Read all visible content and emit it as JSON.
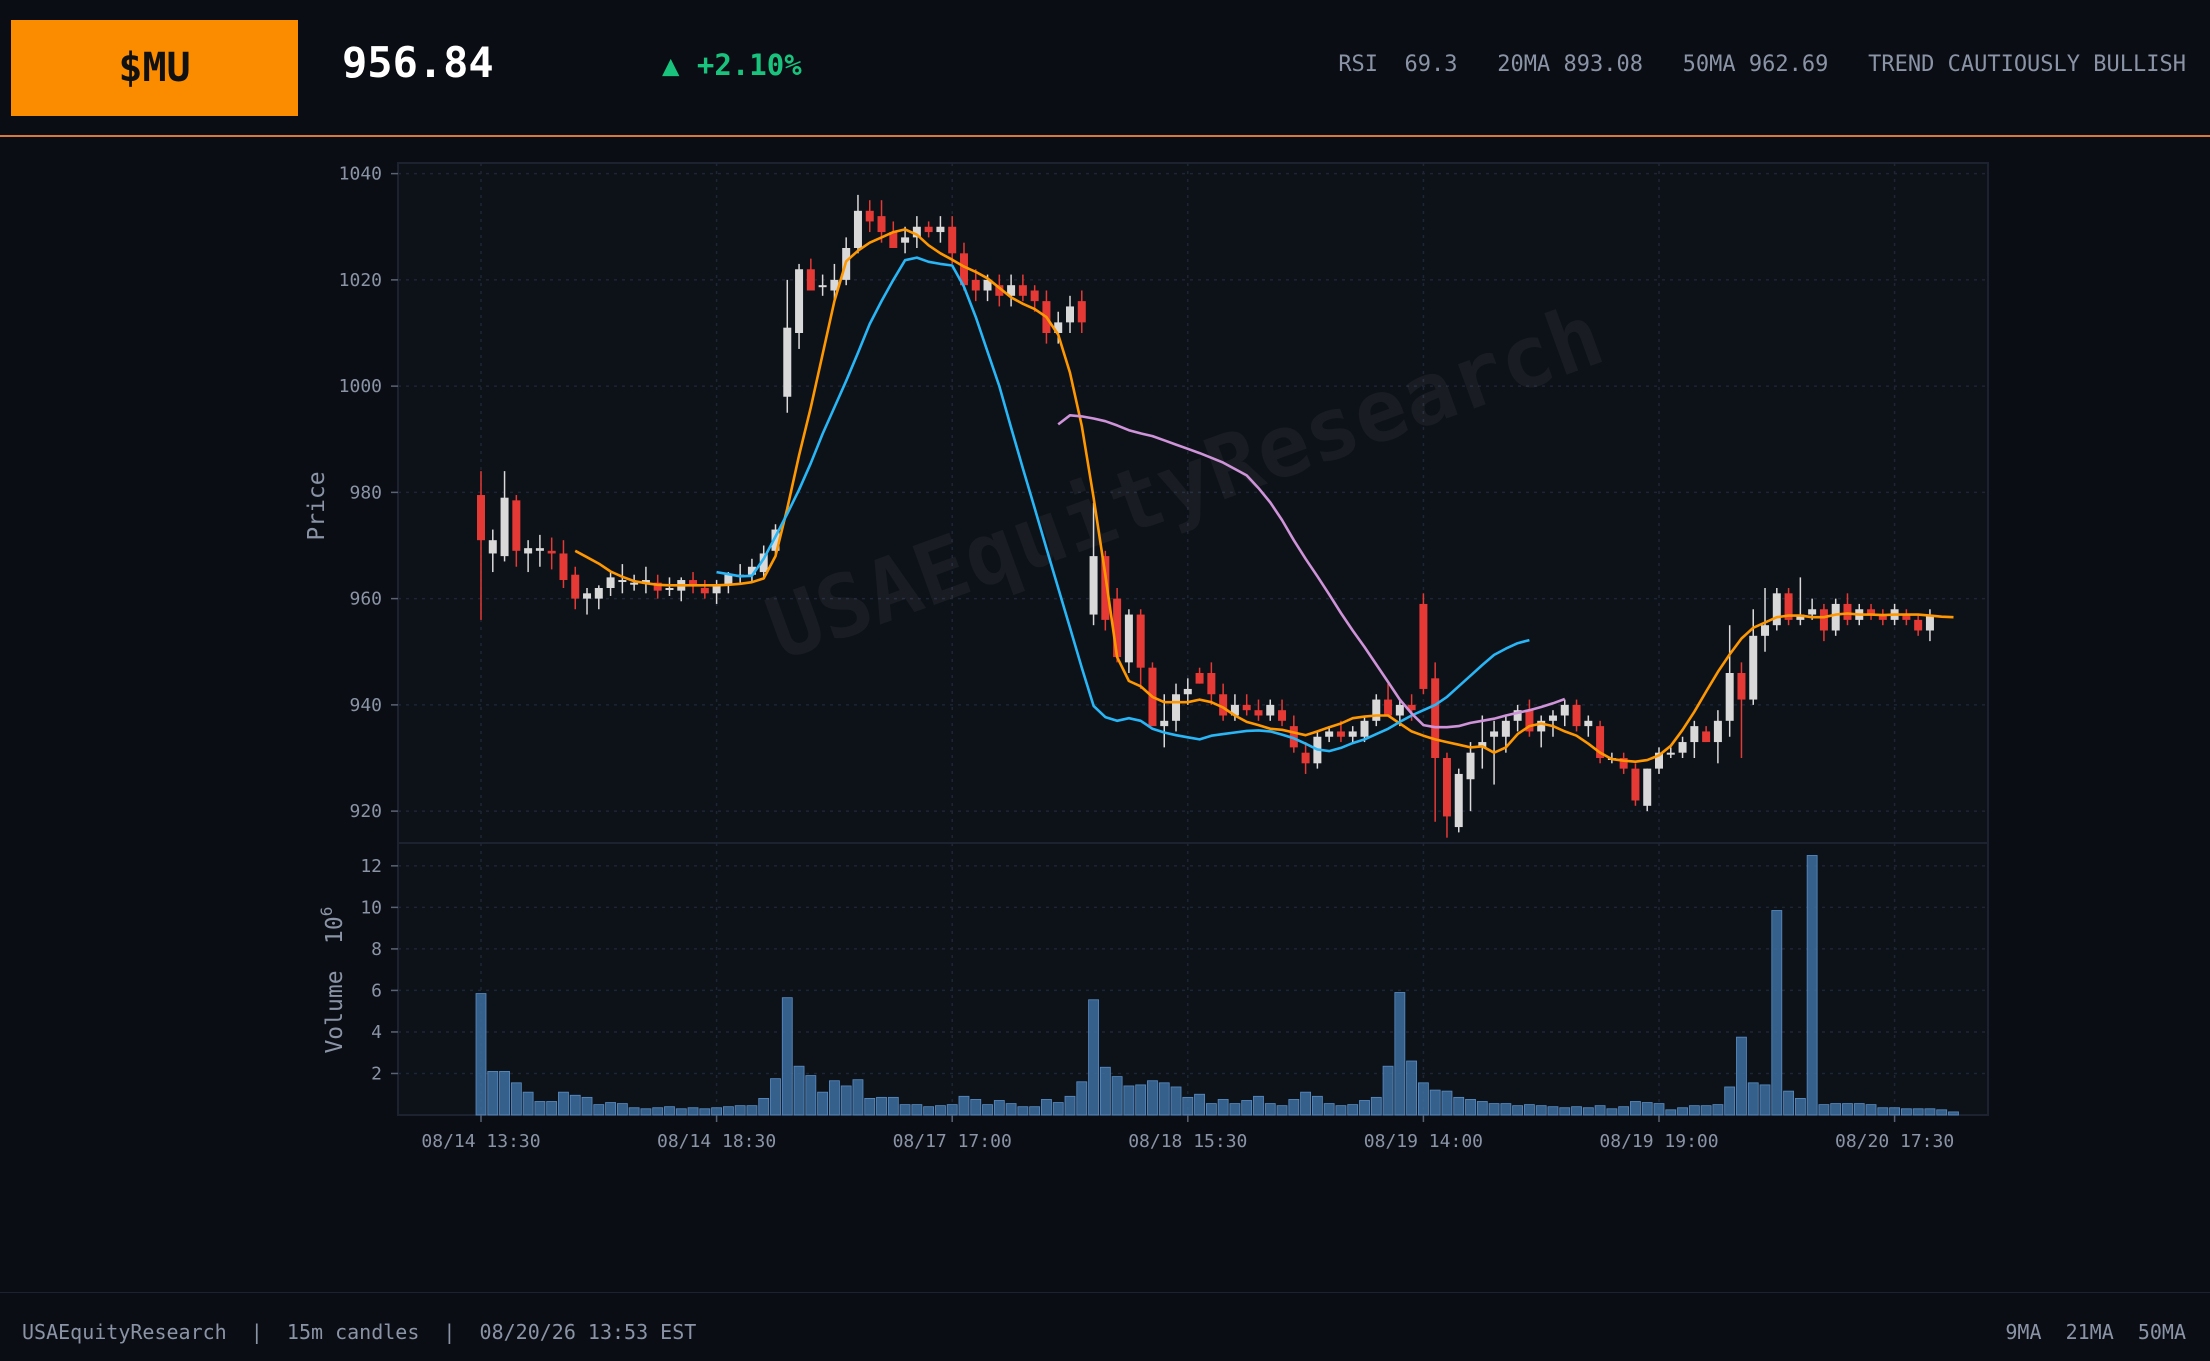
{
  "header": {
    "ticker": "$MU",
    "price": "956.84",
    "change": "▲ +2.10%",
    "stats": "RSI  69.3   20MA 893.08   50MA 962.69   TREND CAUTIOUSLY BULLISH"
  },
  "footer": {
    "left": "USAEquityResearch  |  15m candles  |  08/20/26 13:53 EST",
    "right": "9MA  21MA  50MA"
  },
  "colors": {
    "up": "#d9d9d9",
    "down": "#e53935",
    "ma9": "#ff9800",
    "ma21": "#29b6f6",
    "ma50": "#ce93d8",
    "volume": "#3d6fa0",
    "accent": "#fb8c00",
    "positive": "#19c37d"
  },
  "chart_data": {
    "type": "candlestick",
    "watermark": "USAEquityResearch",
    "ylabel": "Price",
    "vol_label": "Volume",
    "vol_exp": "10",
    "vol_exp_sup": "6",
    "ylim": [
      914,
      1042
    ],
    "yticks": [
      920,
      940,
      960,
      980,
      1000,
      1020,
      1040
    ],
    "vol_ylim": [
      0,
      13.1
    ],
    "vol_yticks": [
      2,
      4,
      6,
      8,
      10,
      12
    ],
    "grid": true,
    "x_tick_index": [
      0,
      20,
      40,
      60,
      80,
      100,
      120
    ],
    "x_tick_labels": [
      "08/14 13:30",
      "08/14 18:30",
      "08/17 17:00",
      "08/18 15:30",
      "08/19 14:00",
      "08/19 19:00",
      "08/20 17:30"
    ],
    "candles": [
      [
        979.5,
        984.0,
        956.0,
        971.0
      ],
      [
        968.5,
        973.0,
        965.0,
        971.0
      ],
      [
        968.0,
        984.0,
        967.0,
        979.0
      ],
      [
        978.5,
        979.5,
        966.0,
        969.0
      ],
      [
        968.5,
        971.0,
        965.0,
        969.5
      ],
      [
        969.0,
        972.0,
        966.0,
        969.5
      ],
      [
        969.0,
        971.5,
        965.5,
        968.5
      ],
      [
        968.5,
        971.0,
        962.0,
        963.5
      ],
      [
        964.5,
        966.0,
        958.0,
        960.0
      ],
      [
        960.0,
        962.0,
        957.0,
        961.0
      ],
      [
        960.0,
        962.5,
        958.0,
        962.0
      ],
      [
        962.0,
        965.0,
        960.5,
        964.0
      ],
      [
        963.5,
        966.5,
        961.0,
        963.5
      ],
      [
        963.0,
        964.5,
        961.5,
        963.0
      ],
      [
        963.0,
        966.0,
        961.0,
        963.5
      ],
      [
        963.0,
        964.5,
        960.0,
        961.5
      ],
      [
        962.0,
        964.0,
        960.5,
        962.0
      ],
      [
        961.5,
        964.0,
        959.5,
        963.5
      ],
      [
        963.5,
        965.0,
        961.0,
        962.5
      ],
      [
        962.0,
        963.5,
        960.0,
        961.0
      ],
      [
        961.0,
        963.5,
        959.0,
        962.5
      ],
      [
        962.5,
        965.0,
        961.0,
        964.5
      ],
      [
        964.5,
        966.5,
        963.0,
        964.5
      ],
      [
        964.5,
        967.5,
        963.0,
        966.0
      ],
      [
        965.0,
        970.0,
        964.0,
        968.5
      ],
      [
        969.0,
        974.0,
        968.0,
        973.0
      ],
      [
        998.0,
        1020.0,
        995.0,
        1011.0
      ],
      [
        1010.0,
        1023.0,
        1007.0,
        1022.0
      ],
      [
        1022.0,
        1024.0,
        1018.0,
        1018.0
      ],
      [
        1019.0,
        1021.0,
        1017.0,
        1019.0
      ],
      [
        1018.0,
        1023.0,
        1016.0,
        1020.0
      ],
      [
        1020.0,
        1028.0,
        1019.0,
        1026.0
      ],
      [
        1026.0,
        1036.0,
        1025.0,
        1033.0
      ],
      [
        1033.0,
        1035.0,
        1029.0,
        1031.0
      ],
      [
        1032.0,
        1035.0,
        1027.0,
        1029.0
      ],
      [
        1029.0,
        1031.0,
        1026.0,
        1026.0
      ],
      [
        1027.0,
        1030.0,
        1025.0,
        1028.0
      ],
      [
        1028.0,
        1032.0,
        1026.0,
        1030.0
      ],
      [
        1030.0,
        1031.0,
        1028.0,
        1029.0
      ],
      [
        1029.0,
        1032.0,
        1027.0,
        1030.0
      ],
      [
        1030.0,
        1032.0,
        1023.0,
        1025.0
      ],
      [
        1025.0,
        1027.0,
        1018.0,
        1019.0
      ],
      [
        1020.0,
        1022.0,
        1016.0,
        1018.0
      ],
      [
        1018.0,
        1021.0,
        1016.0,
        1020.0
      ],
      [
        1019.0,
        1021.0,
        1015.0,
        1017.0
      ],
      [
        1017.0,
        1021.0,
        1015.0,
        1019.0
      ],
      [
        1019.0,
        1021.0,
        1016.0,
        1017.0
      ],
      [
        1018.0,
        1019.0,
        1014.0,
        1016.0
      ],
      [
        1016.0,
        1018.0,
        1008.0,
        1010.0
      ],
      [
        1010.0,
        1014.0,
        1008.0,
        1012.0
      ],
      [
        1012.0,
        1017.0,
        1010.0,
        1015.0
      ],
      [
        1016.0,
        1018.0,
        1010.0,
        1012.0
      ],
      [
        957.0,
        978.0,
        955.0,
        968.0
      ],
      [
        968.0,
        969.0,
        954.0,
        956.0
      ],
      [
        960.0,
        962.0,
        948.0,
        949.0
      ],
      [
        948.0,
        958.0,
        946.0,
        957.0
      ],
      [
        957.0,
        958.0,
        943.0,
        947.0
      ],
      [
        947.0,
        948.0,
        936.0,
        936.0
      ],
      [
        936.0,
        942.0,
        932.0,
        937.0
      ],
      [
        937.0,
        944.0,
        935.0,
        942.0
      ],
      [
        942.0,
        945.0,
        940.0,
        943.0
      ],
      [
        946.0,
        947.0,
        944.0,
        944.0
      ],
      [
        946.0,
        948.0,
        940.0,
        942.0
      ],
      [
        942.0,
        944.0,
        937.0,
        938.0
      ],
      [
        938.0,
        942.0,
        937.0,
        940.0
      ],
      [
        940.0,
        942.0,
        938.0,
        939.0
      ],
      [
        939.0,
        941.0,
        937.0,
        938.0
      ],
      [
        938.0,
        941.0,
        937.0,
        940.0
      ],
      [
        939.0,
        941.0,
        936.0,
        937.0
      ],
      [
        936.0,
        938.0,
        931.0,
        932.0
      ],
      [
        931.0,
        933.0,
        927.0,
        929.0
      ],
      [
        929.0,
        935.0,
        928.0,
        934.0
      ],
      [
        934.0,
        936.0,
        933.0,
        935.0
      ],
      [
        935.0,
        937.0,
        933.0,
        934.0
      ],
      [
        934.0,
        936.0,
        933.0,
        935.0
      ],
      [
        934.0,
        938.0,
        933.0,
        937.0
      ],
      [
        937.0,
        942.0,
        936.0,
        941.0
      ],
      [
        941.0,
        944.0,
        938.0,
        938.0
      ],
      [
        938.0,
        941.0,
        936.0,
        940.0
      ],
      [
        940.0,
        942.0,
        937.0,
        939.0
      ],
      [
        959.0,
        961.0,
        942.0,
        943.0
      ],
      [
        945.0,
        948.0,
        918.0,
        930.0
      ],
      [
        930.0,
        931.0,
        915.0,
        919.0
      ],
      [
        917.0,
        928.0,
        916.0,
        927.0
      ],
      [
        926.0,
        933.0,
        920.0,
        931.0
      ],
      [
        932.0,
        938.0,
        928.0,
        933.0
      ],
      [
        934.0,
        937.0,
        925.0,
        935.0
      ],
      [
        934.0,
        938.0,
        931.0,
        937.0
      ],
      [
        937.0,
        940.0,
        935.0,
        939.0
      ],
      [
        939.0,
        941.0,
        934.0,
        935.0
      ],
      [
        935.0,
        938.0,
        932.0,
        937.0
      ],
      [
        937.0,
        939.0,
        934.0,
        938.0
      ],
      [
        938.0,
        941.0,
        936.0,
        940.0
      ],
      [
        940.0,
        941.0,
        935.0,
        936.0
      ],
      [
        936.0,
        938.0,
        934.0,
        937.0
      ],
      [
        936.0,
        937.0,
        929.0,
        930.0
      ],
      [
        930.0,
        931.0,
        929.0,
        930.0
      ],
      [
        930.0,
        931.0,
        927.0,
        928.0
      ],
      [
        928.0,
        929.0,
        921.0,
        922.0
      ],
      [
        921.0,
        928.0,
        920.0,
        928.0
      ],
      [
        928.0,
        932.0,
        927.0,
        931.0
      ],
      [
        931.0,
        932.0,
        930.0,
        931.0
      ],
      [
        931.0,
        934.0,
        930.0,
        933.0
      ],
      [
        933.0,
        937.0,
        930.0,
        936.0
      ],
      [
        935.0,
        936.0,
        933.0,
        933.0
      ],
      [
        933.0,
        939.0,
        929.0,
        937.0
      ],
      [
        937.0,
        955.0,
        934.0,
        946.0
      ],
      [
        946.0,
        948.0,
        930.0,
        941.0
      ],
      [
        941.0,
        958.0,
        940.0,
        953.0
      ],
      [
        953.0,
        962.0,
        950.0,
        955.0
      ],
      [
        955.0,
        962.0,
        954.0,
        961.0
      ],
      [
        961.0,
        962.0,
        955.0,
        956.0
      ],
      [
        956.0,
        964.0,
        955.0,
        957.0
      ],
      [
        957.0,
        960.0,
        956.0,
        958.0
      ],
      [
        958.0,
        959.0,
        952.0,
        954.0
      ],
      [
        954.0,
        960.0,
        953.0,
        959.0
      ],
      [
        959.0,
        961.0,
        955.0,
        956.0
      ],
      [
        956.0,
        959.0,
        955.0,
        958.0
      ],
      [
        958.0,
        959.0,
        956.0,
        957.0
      ],
      [
        957.0,
        958.0,
        955.0,
        956.0
      ],
      [
        956.0,
        959.0,
        955.0,
        958.0
      ],
      [
        957.0,
        958.0,
        955.0,
        956.0
      ],
      [
        956.0,
        957.0,
        953.0,
        954.0
      ],
      [
        954.0,
        958.0,
        952.0,
        956.8
      ]
    ],
    "volume": [
      5.85,
      2.1,
      2.1,
      1.55,
      1.1,
      0.65,
      0.65,
      1.1,
      0.95,
      0.85,
      0.5,
      0.6,
      0.55,
      0.35,
      0.3,
      0.35,
      0.4,
      0.3,
      0.35,
      0.3,
      0.35,
      0.4,
      0.45,
      0.45,
      0.8,
      1.75,
      5.65,
      2.35,
      1.9,
      1.1,
      1.65,
      1.4,
      1.7,
      0.8,
      0.85,
      0.85,
      0.5,
      0.5,
      0.4,
      0.45,
      0.5,
      0.9,
      0.75,
      0.5,
      0.7,
      0.55,
      0.4,
      0.4,
      0.75,
      0.6,
      0.9,
      1.6,
      5.55,
      2.3,
      1.85,
      1.4,
      1.45,
      1.65,
      1.55,
      1.35,
      0.85,
      1.0,
      0.55,
      0.75,
      0.55,
      0.7,
      0.9,
      0.55,
      0.45,
      0.75,
      1.1,
      0.9,
      0.55,
      0.45,
      0.5,
      0.7,
      0.85,
      2.35,
      5.9,
      2.6,
      1.55,
      1.2,
      1.15,
      0.85,
      0.75,
      0.65,
      0.55,
      0.55,
      0.45,
      0.5,
      0.45,
      0.4,
      0.35,
      0.4,
      0.35,
      0.45,
      0.3,
      0.4,
      0.65,
      0.6,
      0.55,
      0.25,
      0.35,
      0.45,
      0.45,
      0.5,
      1.35,
      3.75,
      1.55,
      1.45,
      9.85,
      1.15,
      0.8,
      12.5,
      0.5,
      0.55,
      0.55,
      0.55,
      0.5,
      0.35,
      0.35,
      0.3,
      0.3,
      0.3,
      0.25,
      0.15
    ],
    "series": [
      {
        "name": "9MA",
        "values": [
          null,
          null,
          null,
          null,
          null,
          null,
          null,
          null,
          969.0,
          967.8,
          966.6,
          965.1,
          964.1,
          963.3,
          962.9,
          962.6,
          962.5,
          962.5,
          962.5,
          962.5,
          962.5,
          962.6,
          962.8,
          963.1,
          963.8,
          968.0,
          977.0,
          987.0,
          996.0,
          1006.0,
          1016.0,
          1023.5,
          1025.5,
          1027.0,
          1028.0,
          1029.0,
          1029.5,
          1028.5,
          1026.5,
          1025.0,
          1023.8,
          1022.5,
          1021.5,
          1020.3,
          1018.5,
          1016.7,
          1015.5,
          1014.5,
          1013.0,
          1009.7,
          1002.5,
          992.5,
          979.0,
          964.5,
          949.0,
          944.5,
          943.5,
          941.5,
          940.5,
          940.5,
          940.5,
          941.0,
          940.5,
          939.5,
          938.0,
          936.8,
          936.2,
          935.5,
          935.3,
          934.8,
          934.3,
          935.0,
          935.8,
          936.5,
          937.5,
          937.8,
          938.0,
          938.0,
          936.5,
          935.0,
          934.2,
          933.5,
          933.0,
          932.5,
          932.0,
          932.2,
          931.0,
          932.0,
          934.5,
          936.0,
          936.5,
          936.0,
          935.0,
          934.2,
          932.7,
          931.0,
          929.8,
          929.5,
          929.3,
          929.6,
          930.5,
          932.3,
          935.3,
          938.7,
          942.5,
          946.2,
          949.5,
          952.5,
          954.5,
          955.5,
          956.5,
          956.8,
          956.8,
          956.5,
          956.5,
          957.0,
          957.2,
          957.0,
          957.0,
          956.9,
          957.0,
          957.0,
          957.0,
          956.8,
          956.6,
          956.5
        ]
      },
      {
        "name": "21MA",
        "values": [
          null,
          null,
          null,
          null,
          null,
          null,
          null,
          null,
          null,
          null,
          null,
          null,
          null,
          null,
          null,
          null,
          null,
          null,
          null,
          null,
          965.0,
          964.6,
          964.2,
          964.3,
          967.5,
          971.7,
          976.0,
          980.5,
          985.5,
          991.0,
          996.0,
          1001.0,
          1006.3,
          1011.7,
          1016.0,
          1020.0,
          1023.7,
          1024.2,
          1023.4,
          1023.0,
          1022.7,
          1018.7,
          1013.0,
          1006.5,
          1000.0,
          992.2,
          984.5,
          977.0,
          969.5,
          962.0,
          954.5,
          947.0,
          939.8,
          937.7,
          937.0,
          937.5,
          937.0,
          935.5,
          934.8,
          934.3,
          933.9,
          933.5,
          934.2,
          934.5,
          934.8,
          935.1,
          935.2,
          935.0,
          934.4,
          933.7,
          932.7,
          931.6,
          931.3,
          931.9,
          932.8,
          933.5,
          934.5,
          935.5,
          936.8,
          938.0,
          939.0,
          940.0,
          941.5,
          943.5,
          945.5,
          947.5,
          949.4,
          950.6,
          951.6,
          952.2
        ]
      },
      {
        "name": "50MA",
        "values": [
          null,
          null,
          null,
          null,
          null,
          null,
          null,
          null,
          null,
          null,
          null,
          null,
          null,
          null,
          null,
          null,
          null,
          null,
          null,
          null,
          null,
          null,
          null,
          null,
          null,
          null,
          null,
          null,
          null,
          null,
          null,
          null,
          null,
          null,
          null,
          null,
          null,
          null,
          null,
          null,
          null,
          null,
          null,
          null,
          null,
          null,
          null,
          null,
          null,
          992.8,
          994.5,
          994.3,
          993.9,
          993.4,
          992.6,
          991.7,
          991.1,
          990.6,
          989.8,
          989.0,
          988.2,
          987.4,
          986.5,
          985.6,
          984.4,
          983.2,
          980.8,
          978.1,
          974.8,
          971.0,
          967.5,
          964.2,
          960.8,
          957.3,
          954.0,
          950.9,
          947.6,
          944.3,
          941.0,
          938.4,
          936.2,
          935.8,
          935.8,
          936.0,
          936.6,
          937.0,
          937.4,
          938.0,
          938.5,
          939.0,
          939.6,
          940.3,
          941.1
        ]
      }
    ]
  }
}
